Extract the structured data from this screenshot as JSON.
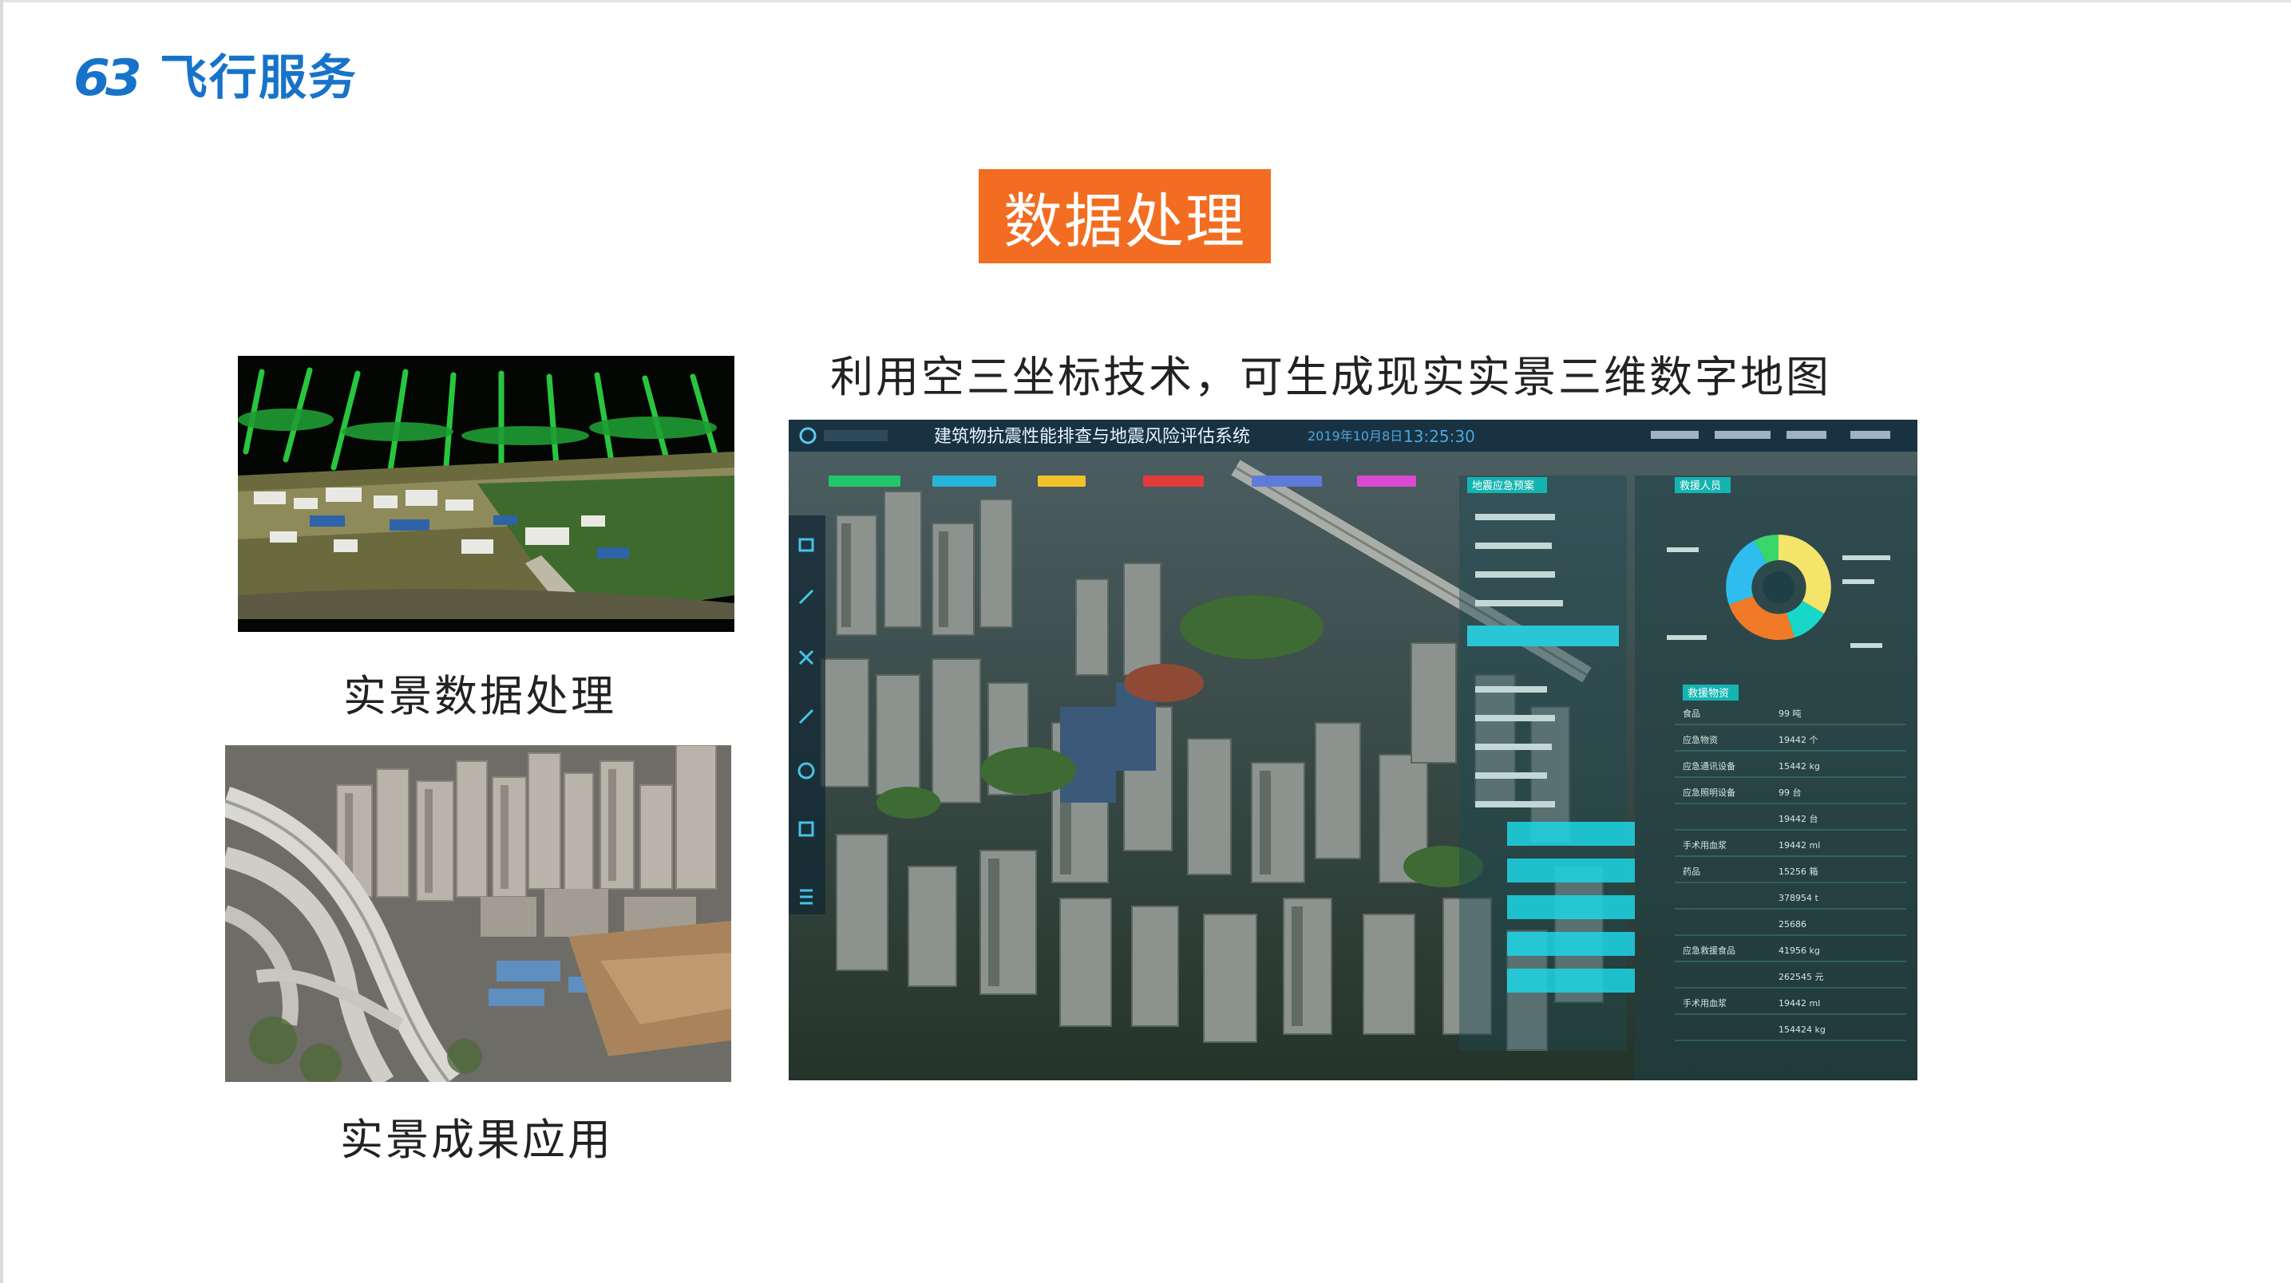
{
  "logo": {
    "mark": "63",
    "text": "飞行服务",
    "color": "#1773c9"
  },
  "title": {
    "text": "数据处理",
    "bg_color": "#f26d21"
  },
  "subtitle": "利用空三坐标技术，可生成现实实景三维数字地图",
  "captions": {
    "data_processing": "实景数据处理",
    "result_application": "实景成果应用"
  },
  "dashboard": {
    "system_title": "建筑物抗震性能排查与地震风险评估系统",
    "date": "2019年10月8日",
    "time": "13:25:30",
    "panel_headers": {
      "plan": "地震应急预案",
      "personnel": "救援人员",
      "materials": "救援物资"
    },
    "materials_rows": [
      {
        "label": "食品",
        "value": "99 吨"
      },
      {
        "label": "应急物资",
        "value": "19442 个"
      },
      {
        "label": "应急通讯设备",
        "value": "15442 kg"
      },
      {
        "label": "应急照明设备",
        "value": "99 台"
      },
      {
        "label": "",
        "value": "19442 台"
      },
      {
        "label": "手术用血浆",
        "value": "19442 ml"
      },
      {
        "label": "药品",
        "value": "15256 箱"
      },
      {
        "label": "",
        "value": "378954 t"
      },
      {
        "label": "",
        "value": "25686"
      },
      {
        "label": "应急救援食品",
        "value": "41956 kg"
      },
      {
        "label": "",
        "value": "262545 元"
      },
      {
        "label": "手术用血浆",
        "value": "19442 ml"
      },
      {
        "label": "",
        "value": "154424 kg"
      }
    ],
    "donut_colors": [
      "#2fbdf0",
      "#f5e46a",
      "#17d8c8",
      "#f07a28",
      "#3ad66a"
    ]
  }
}
